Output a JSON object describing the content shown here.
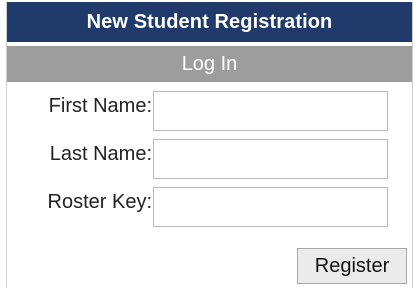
{
  "panel": {
    "title": "New Student Registration",
    "subtitle": "Log In"
  },
  "form": {
    "fields": [
      {
        "label": "First Name:",
        "value": "",
        "placeholder": ""
      },
      {
        "label": "Last Name:",
        "value": "",
        "placeholder": ""
      },
      {
        "label": "Roster Key:",
        "value": "",
        "placeholder": ""
      }
    ],
    "submit_label": "Register"
  },
  "colors": {
    "title_bar": "#1f3a6b",
    "subtitle_bar": "#9d9d9d",
    "button_bg": "#ebebeb"
  }
}
